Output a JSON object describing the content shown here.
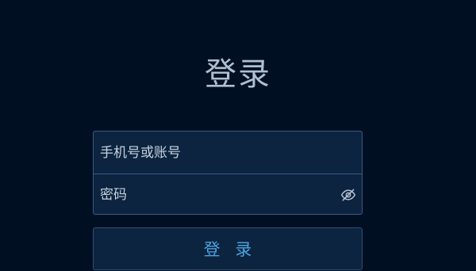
{
  "page": {
    "title": "登录"
  },
  "form": {
    "username": {
      "placeholder": "手机号或账号",
      "value": ""
    },
    "password": {
      "placeholder": "密码",
      "value": "",
      "toggle_icon": "eye-off-icon"
    }
  },
  "actions": {
    "login_label": "登 录"
  },
  "colors": {
    "background": "#000f22",
    "field_background": "#0c2440",
    "border": "#3a5a80",
    "title_text": "#aebfd0",
    "field_text": "#c6d2de",
    "accent": "#4aa3dc"
  }
}
